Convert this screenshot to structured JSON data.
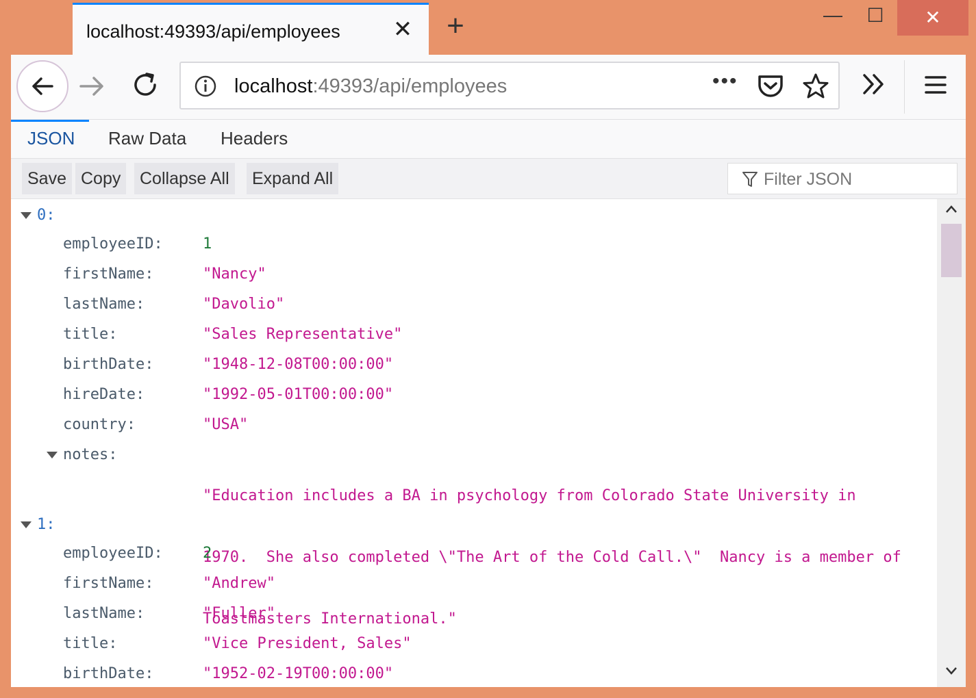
{
  "tab": {
    "title": "localhost:49393/api/employees",
    "close": "✕",
    "new_tab": "+"
  },
  "window_controls": {
    "minimize": "—",
    "maximize": "☐",
    "close": "✕"
  },
  "urlbar": {
    "host": "localhost",
    "path": ":49393/api/employees",
    "page_actions": "•••"
  },
  "viewer_tabs": [
    "JSON",
    "Raw Data",
    "Headers"
  ],
  "toolbar": {
    "save": "Save",
    "copy": "Copy",
    "collapse_all": "Collapse All",
    "expand_all": "Expand All",
    "filter_placeholder": "Filter JSON"
  },
  "records": [
    {
      "index": "0:",
      "fields": [
        {
          "key": "employeeID:",
          "value": "1",
          "type": "number"
        },
        {
          "key": "firstName:",
          "value": "\"Nancy\""
        },
        {
          "key": "lastName:",
          "value": "\"Davolio\""
        },
        {
          "key": "title:",
          "value": "\"Sales Representative\""
        },
        {
          "key": "birthDate:",
          "value": "\"1948-12-08T00:00:00\""
        },
        {
          "key": "hireDate:",
          "value": "\"1992-05-01T00:00:00\""
        },
        {
          "key": "country:",
          "value": "\"USA\""
        }
      ],
      "notes_key": "notes:",
      "notes_lines": [
        "\"Education includes a BA in psychology from Colorado State University in",
        "1970.  She also completed \\\"The Art of the Cold Call.\\\"  Nancy is a member of",
        "Toastmasters International.\""
      ]
    },
    {
      "index": "1:",
      "fields": [
        {
          "key": "employeeID:",
          "value": "2",
          "type": "number"
        },
        {
          "key": "firstName:",
          "value": "\"Andrew\""
        },
        {
          "key": "lastName:",
          "value": "\"Fuller\""
        },
        {
          "key": "title:",
          "value": "\"Vice President, Sales\""
        },
        {
          "key": "birthDate:",
          "value": "\"1952-02-19T00:00:00\""
        }
      ]
    }
  ]
}
